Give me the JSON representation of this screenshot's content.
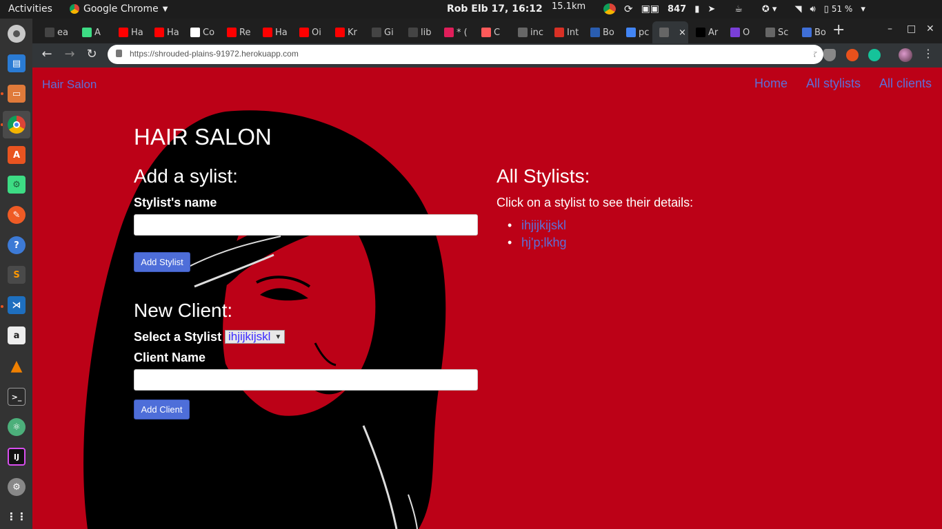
{
  "os": {
    "activities": "Activities",
    "app_name": "Google Chrome",
    "clock": "Rob Elb 17, 16:12",
    "net_speed": "15.1km",
    "counter": "847",
    "battery": "51 %"
  },
  "browser": {
    "tabs": [
      {
        "label": "ea",
        "favicon": "github-icon",
        "color": "#444444"
      },
      {
        "label": "A",
        "favicon": "android-icon",
        "color": "#3ddc84"
      },
      {
        "label": "Ha",
        "favicon": "youtube-icon",
        "color": "#ff0000"
      },
      {
        "label": "Ha",
        "favicon": "youtube-icon",
        "color": "#ff0000"
      },
      {
        "label": "Co",
        "favicon": "page-icon",
        "color": "#ffffff"
      },
      {
        "label": "Re",
        "favicon": "youtube-icon",
        "color": "#ff0000"
      },
      {
        "label": "Ha",
        "favicon": "youtube-icon",
        "color": "#ff0000"
      },
      {
        "label": "Oi",
        "favicon": "youtube-icon",
        "color": "#ff0000"
      },
      {
        "label": "Kr",
        "favicon": "youtube-icon",
        "color": "#ff0000"
      },
      {
        "label": "Gi",
        "favicon": "github-icon",
        "color": "#444444"
      },
      {
        "label": "lib",
        "favicon": "github-icon",
        "color": "#444444"
      },
      {
        "label": "* (",
        "favicon": "slack-icon",
        "color": "#e01e5a"
      },
      {
        "label": "C",
        "favicon": "page-icon",
        "color": "#ff5a5a"
      },
      {
        "label": "inc",
        "favicon": "doc-icon",
        "color": "#666666"
      },
      {
        "label": "Int",
        "favicon": "gmail-icon",
        "color": "#d93025"
      },
      {
        "label": "Bo",
        "favicon": "mdn-icon",
        "color": "#2a5db0"
      },
      {
        "label": "pc",
        "favicon": "google-icon",
        "color": "#4285f4"
      },
      {
        "label": "",
        "favicon": "doc-icon",
        "color": "#666666",
        "active": true
      },
      {
        "label": "Ar",
        "favicon": "medium-icon",
        "color": "#000000"
      },
      {
        "label": "O",
        "favicon": "circles-icon",
        "color": "#7a3fd8"
      },
      {
        "label": "Sc",
        "favicon": "doc-icon",
        "color": "#666666"
      },
      {
        "label": "Bo",
        "favicon": "bootstrap-icon",
        "color": "#3f6fd8"
      }
    ],
    "new_tab": "+",
    "url": "https://shrouded-plains-91972.herokuapp.com"
  },
  "page": {
    "brand": "Hair Salon",
    "nav": {
      "home": "Home",
      "all_stylists": "All stylists",
      "all_clients": "All clients"
    },
    "title": "HAIR SALON",
    "add_stylist": {
      "heading": "Add a sylist:",
      "name_label": "Stylist's name",
      "name_value": "",
      "button": "Add Stylist"
    },
    "new_client": {
      "heading": "New Client:",
      "select_label": "Select a Stylist",
      "selected_stylist": "ihjijkijskl",
      "client_label": "Client Name",
      "client_value": "",
      "button": "Add Client"
    },
    "all_stylists": {
      "heading": "All Stylists:",
      "helper": "Click on a stylist to see their details:",
      "items": [
        "ihjijkijskl",
        "hj'p;lkhg"
      ]
    },
    "colors": {
      "background": "#bc0117",
      "link": "#5e6fd8",
      "button": "#4e6ed9"
    }
  }
}
